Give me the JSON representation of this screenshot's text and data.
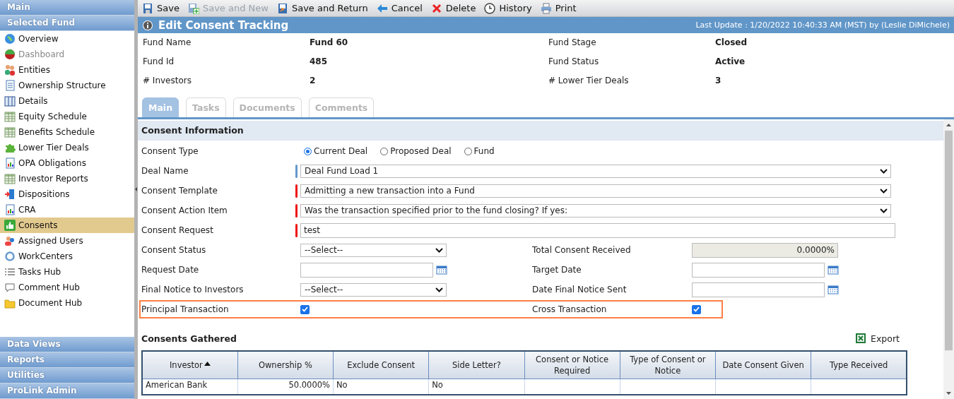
{
  "sidebar": {
    "headers": [
      {
        "label": "Main"
      },
      {
        "label": "Selected Fund"
      }
    ],
    "items": [
      {
        "label": "Overview",
        "selected": false,
        "disabled": false
      },
      {
        "label": "Dashboard",
        "selected": false,
        "disabled": true
      },
      {
        "label": "Entities",
        "selected": false,
        "disabled": false
      },
      {
        "label": "Ownership Structure",
        "selected": false,
        "disabled": false
      },
      {
        "label": "Details",
        "selected": false,
        "disabled": false
      },
      {
        "label": "Equity Schedule",
        "selected": false,
        "disabled": false
      },
      {
        "label": "Benefits Schedule",
        "selected": false,
        "disabled": false
      },
      {
        "label": "Lower Tier Deals",
        "selected": false,
        "disabled": false
      },
      {
        "label": "OPA Obligations",
        "selected": false,
        "disabled": false
      },
      {
        "label": "Investor Reports",
        "selected": false,
        "disabled": false
      },
      {
        "label": "Dispositions",
        "selected": false,
        "disabled": false
      },
      {
        "label": "CRA",
        "selected": false,
        "disabled": false
      },
      {
        "label": "Consents",
        "selected": true,
        "disabled": false
      },
      {
        "label": "Assigned Users",
        "selected": false,
        "disabled": false
      },
      {
        "label": "WorkCenters",
        "selected": false,
        "disabled": false
      },
      {
        "label": "Tasks Hub",
        "selected": false,
        "disabled": false
      },
      {
        "label": "Comment Hub",
        "selected": false,
        "disabled": false
      },
      {
        "label": "Document Hub",
        "selected": false,
        "disabled": false
      }
    ],
    "footer_headers": [
      {
        "label": "Data Views"
      },
      {
        "label": "Reports"
      },
      {
        "label": "Utilities"
      },
      {
        "label": "ProLink Admin"
      }
    ]
  },
  "toolbar": [
    {
      "label": "Save",
      "disabled": false
    },
    {
      "label": "Save and New",
      "disabled": true
    },
    {
      "label": "Save and Return",
      "disabled": false
    },
    {
      "label": "Cancel",
      "disabled": false
    },
    {
      "label": "Delete",
      "disabled": false
    },
    {
      "label": "History",
      "disabled": false
    },
    {
      "label": "Print",
      "disabled": false
    }
  ],
  "header": {
    "title": "Edit Consent Tracking",
    "last_update": "Last Update : 1/20/2022 10:40:33 AM (MST) by (Leslie DiMichele)"
  },
  "summary": [
    {
      "label": "Fund Name",
      "value": "Fund 60"
    },
    {
      "label": "Fund Stage",
      "value": "Closed"
    },
    {
      "label": "Fund Id",
      "value": "485"
    },
    {
      "label": "Fund Status",
      "value": "Active"
    },
    {
      "label": "# Investors",
      "value": "2"
    },
    {
      "label": "# Lower Tier Deals",
      "value": "3"
    }
  ],
  "tabs": [
    {
      "label": "Main",
      "selected": true
    },
    {
      "label": "Tasks",
      "selected": false
    },
    {
      "label": "Documents",
      "selected": false
    },
    {
      "label": "Comments",
      "selected": false
    }
  ],
  "section_title": "Consent Information",
  "form_rows": [
    {
      "highlighted": false,
      "fields": [
        {
          "kind": "radio",
          "label": "Consent Type",
          "options": [
            {
              "label": "Current Deal",
              "selected": true
            },
            {
              "label": "Proposed Deal",
              "selected": false
            },
            {
              "label": "Fund",
              "selected": false
            }
          ]
        }
      ]
    },
    {
      "highlighted": false,
      "fields": [
        {
          "kind": "select",
          "label": "Deal Name",
          "value": "Deal Fund Load 1",
          "color": "#6699cc"
        }
      ]
    },
    {
      "highlighted": false,
      "fields": [
        {
          "kind": "select",
          "label": "Consent Template",
          "value": "Admitting a new transaction into a Fund",
          "color": "#ee1111"
        }
      ]
    },
    {
      "highlighted": false,
      "fields": [
        {
          "kind": "select",
          "label": "Consent Action Item",
          "value": "Was the transaction specified prior to the fund closing? If yes:",
          "color": "#ee1111"
        }
      ]
    },
    {
      "highlighted": false,
      "fields": [
        {
          "kind": "text",
          "label": "Consent Request",
          "value": "test",
          "color": "#ee1111"
        }
      ]
    },
    {
      "highlighted": false,
      "fields": [
        {
          "kind": "select",
          "label": "Consent Status",
          "value": "--Select--"
        },
        {
          "kind": "readonly",
          "label": "Total Consent Received",
          "value": "0.0000%"
        }
      ]
    },
    {
      "highlighted": false,
      "fields": [
        {
          "kind": "date",
          "label": "Request Date"
        },
        {
          "kind": "date",
          "label": "Target Date"
        }
      ]
    },
    {
      "highlighted": false,
      "fields": [
        {
          "kind": "select",
          "label": "Final Notice to Investors",
          "value": "--Select--"
        },
        {
          "kind": "date",
          "label": "Date Final Notice Sent"
        }
      ]
    },
    {
      "highlighted": true,
      "fields": [
        {
          "kind": "checkbox",
          "label": "Principal Transaction",
          "checked": true
        },
        {
          "kind": "checkbox",
          "label": "Cross Transaction",
          "checked": true
        }
      ]
    }
  ],
  "consents": {
    "title": "Consents Gathered",
    "export_label": "Export",
    "columns": [
      {
        "label": "Investor",
        "kind": "text",
        "sorted": true
      },
      {
        "label": "Ownership %",
        "kind": "number",
        "sorted": false
      },
      {
        "label": "Exclude Consent",
        "kind": "text",
        "sorted": false
      },
      {
        "label": "Side Letter?",
        "kind": "text",
        "sorted": false
      },
      {
        "label": "Consent or Notice Required",
        "kind": "text",
        "sorted": false
      },
      {
        "label": "Type of Consent or Notice",
        "kind": "text",
        "sorted": false
      },
      {
        "label": "Date Consent Given",
        "kind": "text",
        "sorted": false
      },
      {
        "label": "Type Received",
        "kind": "text",
        "sorted": false
      }
    ],
    "rows": [
      {
        "cells": [
          "American Bank",
          "50.0000%",
          "No",
          "No"
        ]
      }
    ]
  }
}
